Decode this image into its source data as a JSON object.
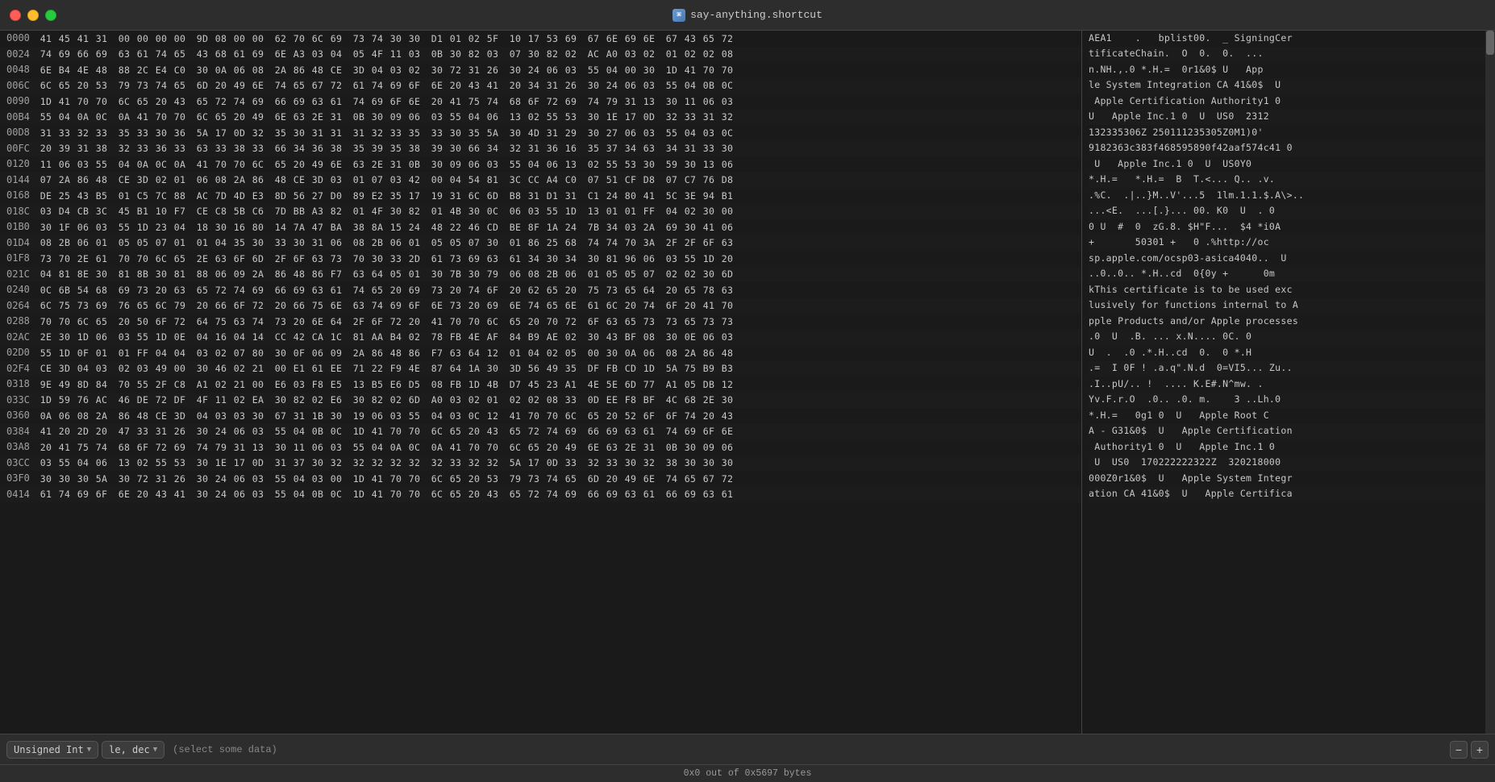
{
  "titlebar": {
    "title": "say-anything.shortcut",
    "icon": "📋"
  },
  "hex_rows": [
    {
      "addr": "0000",
      "bytes": [
        "41454131",
        "00000000",
        "9D080000",
        "62706C69",
        "73743030",
        "D101025F",
        "10175369",
        "676E696E",
        "67436572"
      ],
      "ascii": "AEA1    .   bplist00.  _ SigningCer"
    },
    {
      "addr": "0024",
      "bytes": [
        "74696669",
        "63617465",
        "43686169",
        "6EA30304",
        "054F1103",
        "0B308203",
        "07308202",
        "ACA00302",
        "01020208"
      ],
      "ascii": "tificateChain.  O  0.  0.  ..."
    },
    {
      "addr": "0048",
      "bytes": [
        "6EB44E48",
        "882CE4C0",
        "300A0608",
        "2A8648CE",
        "3D040302",
        "30723126",
        "30240603",
        "55040030",
        "1D417070"
      ],
      "ascii": "n.NH.,.0 *.H.=  0r1&0$ U   App"
    },
    {
      "addr": "006C",
      "bytes": [
        "6C652053",
        "79737465",
        "6D20496E",
        "74656772",
        "6174696F",
        "6E204341",
        "20343126",
        "30240603",
        "55040B0C"
      ],
      "ascii": "le System Integration CA 41&0$  U"
    },
    {
      "addr": "0090",
      "bytes": [
        "1D417070",
        "6C652043",
        "65727469",
        "66696361",
        "74696F6E",
        "20417574",
        "686F7269",
        "74793113",
        "30110603"
      ],
      "ascii": " Apple Certification Authority1 0"
    },
    {
      "addr": "00B4",
      "bytes": [
        "55040A0C",
        "0A417070",
        "6C652049",
        "6E632E31",
        "0B300906",
        "03550406",
        "13025553",
        "301E170D",
        "32333132"
      ],
      "ascii": "U   Apple Inc.1 0  U  US0  2312"
    },
    {
      "addr": "00D8",
      "bytes": [
        "31333233",
        "35333036",
        "5A170D32",
        "35303131",
        "31323335",
        "3330355A",
        "304D3129",
        "30270603",
        "5504030C"
      ],
      "ascii": "132335306Z 250111235305Z0M1)0'"
    },
    {
      "addr": "00FC",
      "bytes": [
        "20393138",
        "32333633",
        "63333833",
        "66343638",
        "35393538",
        "39306634",
        "32313616",
        "35373463",
        "34313330"
      ],
      "ascii": "9182363c383f468595890f42aaf574c41 0"
    },
    {
      "addr": "0120",
      "bytes": [
        "11060355",
        "040A0C0A",
        "4170706C",
        "6520496E",
        "632E310B",
        "30090603",
        "55040613",
        "02555330",
        "59301306"
      ],
      "ascii": " U   Apple Inc.1 0  U  US0Y0"
    },
    {
      "addr": "0144",
      "bytes": [
        "072A8648",
        "CE3D0201",
        "06082A86",
        "48CE3D03",
        "01070342",
        "00045481",
        "3CCCA4C0",
        "0751CFD8",
        "07C776D8"
      ],
      "ascii": "*.H.=   *.H.=  B  T.<... Q.. .v."
    },
    {
      "addr": "0168",
      "bytes": [
        "DE2543B5",
        "01C57C88",
        "AC7D4DE3",
        "8D5627D0",
        "89E23517",
        "19316C6D",
        "B831D131",
        "C1248041",
        "5C3E94B1"
      ],
      "ascii": ".%C.  .|..}M..V'...5  1lm.1.1.$.A\\>.."
    },
    {
      "addr": "018C",
      "bytes": [
        "03D4CB3C",
        "45B110F7",
        "CEC85BC6",
        "7DBBA382",
        "014F3082",
        "014B300C",
        "0603551D",
        "130101FF",
        "04023000"
      ],
      "ascii": "...<E.  ...[.}... 00. K0  U  . 0"
    },
    {
      "addr": "01B0",
      "bytes": [
        "301F0603",
        "551D2304",
        "18301680",
        "147A47BA",
        "388A1524",
        "482246CD",
        "BE8F1A24",
        "7B34032A",
        "69304106"
      ],
      "ascii": "0 U  #  0  zG.8. $H\"F...  $4 *i0A"
    },
    {
      "addr": "01D4",
      "bytes": [
        "082B0601",
        "05050701",
        "01043530",
        "33303106",
        "082B0601",
        "05050730",
        "01862568",
        "7474703A",
        "2F2F6F63"
      ],
      "ascii": "+       50301 +   0 .%http://oc"
    },
    {
      "addr": "01F8",
      "bytes": [
        "73702E61",
        "70706C65",
        "2E636F6D",
        "2F6F6373",
        "7030332D",
        "61736963",
        "61343034",
        "30819606",
        "03551D20"
      ],
      "ascii": "sp.apple.com/ocsp03-asica4040..  U"
    },
    {
      "addr": "021C",
      "bytes": [
        "04818E30",
        "818B3081",
        "8806092A",
        "864886F7",
        "63640501",
        "307B3079",
        "06082B06",
        "01050507",
        "0202306D"
      ],
      "ascii": "..0..0.. *.H..cd  0{0y +      0m"
    },
    {
      "addr": "0240",
      "bytes": [
        "0C6B5468",
        "69732063",
        "65727469",
        "66696361",
        "74652069",
        "7320746F",
        "20626520",
        "75736564",
        "20657863"
      ],
      "ascii": "kThis certificate is to be used exc"
    },
    {
      "addr": "0264",
      "bytes": [
        "6C757369",
        "76656C79",
        "20666F72",
        "2066756E",
        "6374696F",
        "6E732069",
        "6E74656E",
        "616C2074",
        "6F204170"
      ],
      "ascii": "lusively for functions internal to A"
    },
    {
      "addr": "0288",
      "bytes": [
        "70706C65",
        "20506F72",
        "64756374",
        "73206E64",
        "2F6F7220",
        "4170706C",
        "65207072",
        "6F636573",
        "73657373"
      ],
      "ascii": "pple Products and/or Apple processes"
    },
    {
      "addr": "02AC",
      "bytes": [
        "2E301D06",
        "03551D0E",
        "04160414",
        "CC42CA1C",
        "81AAB402",
        "78FB4EAF",
        "84B9AE02",
        "3043BF08",
        "300E0603"
      ],
      "ascii": ".0  U  .B. ... x.N.... 0C. 0"
    },
    {
      "addr": "02D0",
      "bytes": [
        "551D0F01",
        "01FF0404",
        "03020780",
        "300F0609",
        "2A864886",
        "F7636412",
        "01040205",
        "00300A06",
        "082A8648"
      ],
      "ascii": "U  .  .0 .*.H..cd  0.  0 *.H"
    },
    {
      "addr": "02F4",
      "bytes": [
        "CE3D0403",
        "02034900",
        "30460221",
        "00E161EE",
        "7122F94E",
        "87641A30",
        "3D564935",
        "DFFBCD1D",
        "5A75B9B3"
      ],
      "ascii": ".=  I 0F ! .a.q\".N.d  0=VI5... Zu.."
    },
    {
      "addr": "0318",
      "bytes": [
        "9E498D84",
        "70552FC8",
        "A1022100",
        "E603F8E5",
        "13B5E6D5",
        "08FB1D4B",
        "D74523A1",
        "4E5E6D77",
        "A105DB12"
      ],
      "ascii": ".I..pU/.. !  .... K.E#.N^mw. ."
    },
    {
      "addr": "033C",
      "bytes": [
        "1D5976AC",
        "46DE72DF",
        "4F1102EA",
        "308202E6",
        "3082026D",
        "A0030201",
        "02020833",
        "0DEEF8BF",
        "4C682E30"
      ],
      "ascii": "Yv.F.r.O  .0.. .0. m.    3 ..Lh.0"
    },
    {
      "addr": "0360",
      "bytes": [
        "0A06082A",
        "8648CE3D",
        "04030330",
        "67311B30",
        "19060355",
        "04030C12",
        "4170706C",
        "6520526F",
        "6F742043"
      ],
      "ascii": "*.H.=   0g1 0  U   Apple Root C"
    },
    {
      "addr": "0384",
      "bytes": [
        "41202D20",
        "47333126",
        "30240603",
        "55040B0C",
        "1D417070",
        "6C652043",
        "65727469",
        "66696361",
        "74696F6E"
      ],
      "ascii": "A - G31&0$  U   Apple Certification"
    },
    {
      "addr": "03A8",
      "bytes": [
        "20417574",
        "686F7269",
        "74793113",
        "30110603",
        "55040A0C",
        "0A417070",
        "6C652049",
        "6E632E31",
        "0B300906"
      ],
      "ascii": " Authority1 0  U   Apple Inc.1 0"
    },
    {
      "addr": "03CC",
      "bytes": [
        "03550406",
        "13025553",
        "301E170D",
        "31373032",
        "32323232",
        "32333232",
        "5A170D33",
        "32333032",
        "38303030"
      ],
      "ascii": " U  US0  170222222322Z  320218000"
    },
    {
      "addr": "03F0",
      "bytes": [
        "3030305A",
        "30723126",
        "30240603",
        "55040300",
        "1D417070",
        "6C652053",
        "79737465",
        "6D20496E",
        "74656772"
      ],
      "ascii": "000Z0r1&0$  U   Apple System Integr"
    },
    {
      "addr": "0414",
      "bytes": [
        "6174696F",
        "6E204341",
        "30240603",
        "55040B0C",
        "1D417070",
        "6C652043",
        "65727469",
        "66696361",
        "66696361"
      ],
      "ascii": "ation CA 41&0$  U   Apple Certifica"
    }
  ],
  "status": {
    "text": "0x0 out of 0x5697 bytes"
  },
  "bottom": {
    "type_label": "Unsigned Int",
    "format_label": "le, dec",
    "hint": "(select some data)",
    "minus_label": "−",
    "plus_label": "+"
  }
}
